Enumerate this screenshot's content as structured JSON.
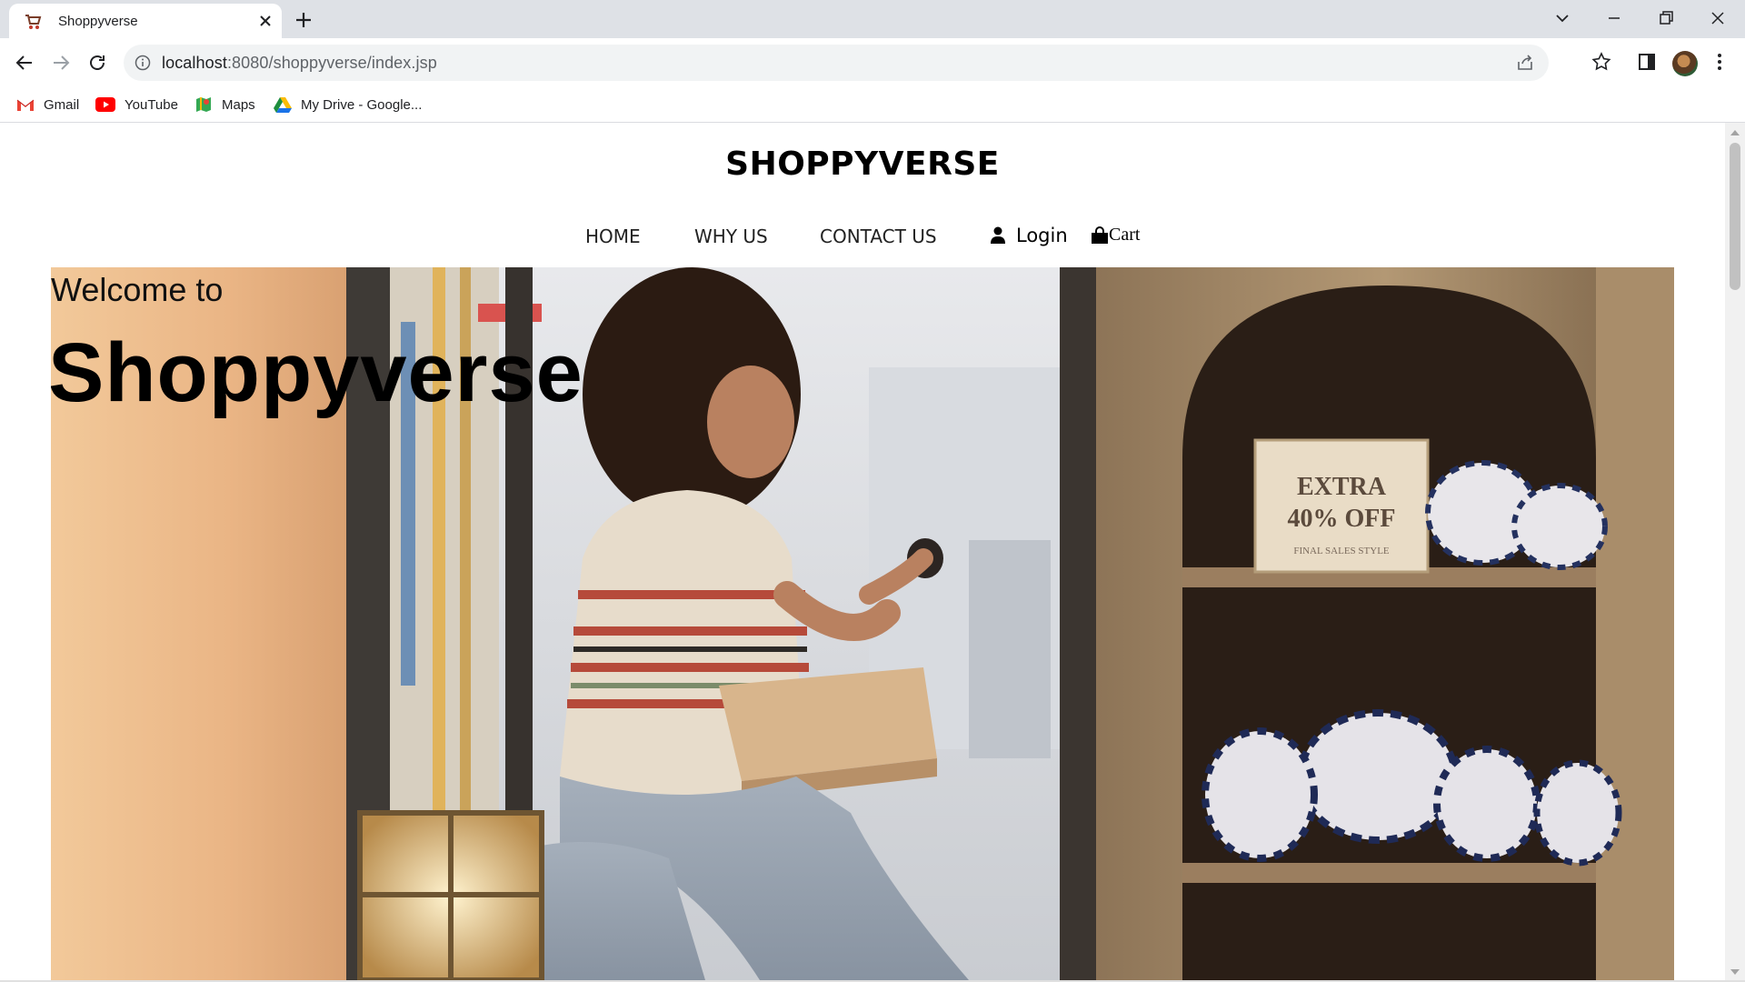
{
  "browser": {
    "tab_title": "Shoppyverse",
    "url_host": "localhost",
    "url_rest": ":8080/shoppyverse/index.jsp",
    "bookmarks": [
      {
        "label": "Gmail",
        "icon": "gmail-icon"
      },
      {
        "label": "YouTube",
        "icon": "youtube-icon"
      },
      {
        "label": "Maps",
        "icon": "maps-icon"
      },
      {
        "label": "My Drive - Google...",
        "icon": "drive-icon"
      }
    ]
  },
  "site": {
    "brand": "SHOPPYVERSE",
    "nav": [
      {
        "label": "HOME"
      },
      {
        "label": "WHY US"
      },
      {
        "label": "CONTACT US"
      }
    ],
    "login_label": "Login",
    "cart_label": "Cart"
  },
  "hero": {
    "welcome": "Welcome to",
    "title": "Shoppyverse",
    "sign_line1": "EXTRA",
    "sign_line2": "40% OFF",
    "sign_line3": "FINAL SALES STYLE"
  },
  "colors": {
    "tabstrip": "#dee1e6",
    "omnibox": "#f1f3f4",
    "text": "#202124"
  }
}
